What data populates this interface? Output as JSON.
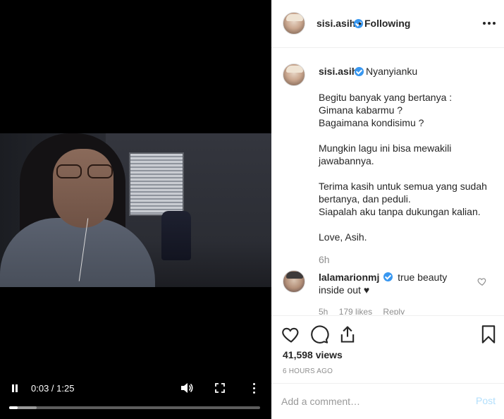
{
  "post": {
    "author": "sisi.asih",
    "separator": "•",
    "follow_status": "Following"
  },
  "caption": {
    "author": "sisi.asih",
    "title": "Nyanyianku",
    "paragraphs": [
      [
        "Begitu banyak yang bertanya :",
        "Gimana kabarmu ?",
        "Bagaimana kondisimu ?"
      ],
      [
        "Mungkin lagu ini bisa mewakili",
        "jawabannya."
      ],
      [
        "Terima kasih untuk semua yang sudah",
        "bertanya, dan peduli.",
        "Siapalah aku tanpa dukungan kalian."
      ],
      [
        "Love, Asih."
      ]
    ],
    "time": "6h"
  },
  "comment": {
    "author": "lalamarionmj",
    "text_line1": "true beauty",
    "text_line2": "inside out ♥",
    "time": "5h",
    "likes": "179 likes",
    "reply_label": "Reply"
  },
  "video": {
    "current_time": "0:03",
    "duration": "1:25",
    "time_display": "0:03 / 1:25",
    "progress_fraction": 0.035,
    "buffered_fraction": 0.11
  },
  "stats": {
    "views": "41,598 views",
    "posted": "6 HOURS AGO"
  },
  "comment_box": {
    "placeholder": "Add a comment…",
    "post_label": "Post"
  },
  "colors": {
    "verified": "#3897f0",
    "post_disabled": "#b2dffc",
    "muted_text": "#8e8e8e"
  },
  "icons": {
    "pause": "pause-icon",
    "volume": "volume-icon",
    "fullscreen": "fullscreen-icon",
    "video_menu": "menu-icon",
    "like": "heart-icon",
    "comment": "comment-icon",
    "share": "share-icon",
    "save": "bookmark-icon",
    "more": "more-icon"
  }
}
